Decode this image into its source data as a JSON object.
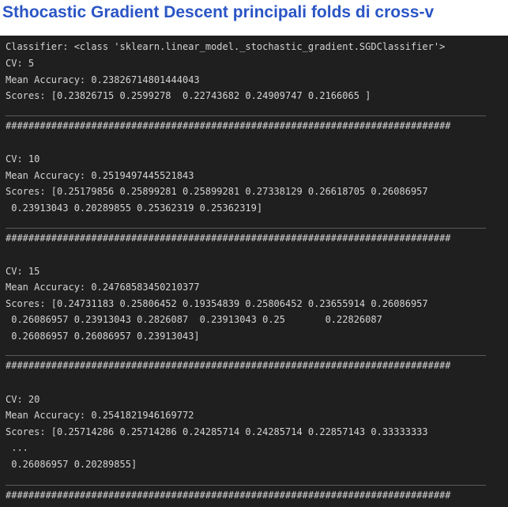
{
  "title": "Sthocastic Gradient Descent principali folds di cross-v",
  "output": {
    "classifier_line": "Classifier: <class 'sklearn.linear_model._stochastic_gradient.SGDClassifier'>",
    "hash_line": "##############################################################################",
    "blocks": [
      {
        "cv": "CV: 5",
        "mean": "Mean Accuracy: 0.23826714801444043",
        "scores": [
          "Scores: [0.23826715 0.2599278  0.22743682 0.24909747 0.2166065 ]"
        ]
      },
      {
        "cv": "CV: 10",
        "mean": "Mean Accuracy: 0.2519497445521843",
        "scores": [
          "Scores: [0.25179856 0.25899281 0.25899281 0.27338129 0.26618705 0.26086957",
          " 0.23913043 0.20289855 0.25362319 0.25362319]"
        ]
      },
      {
        "cv": "CV: 15",
        "mean": "Mean Accuracy: 0.24768583450210377",
        "scores": [
          "Scores: [0.24731183 0.25806452 0.19354839 0.25806452 0.23655914 0.26086957",
          " 0.26086957 0.23913043 0.2826087  0.23913043 0.25       0.22826087",
          " 0.26086957 0.26086957 0.23913043]"
        ]
      },
      {
        "cv": "CV: 20",
        "mean": "Mean Accuracy: 0.2541821946169772",
        "scores": [
          "Scores: [0.25714286 0.25714286 0.24285714 0.24285714 0.22857143 0.33333333",
          " ...",
          " 0.26086957 0.20289855]"
        ]
      }
    ]
  }
}
